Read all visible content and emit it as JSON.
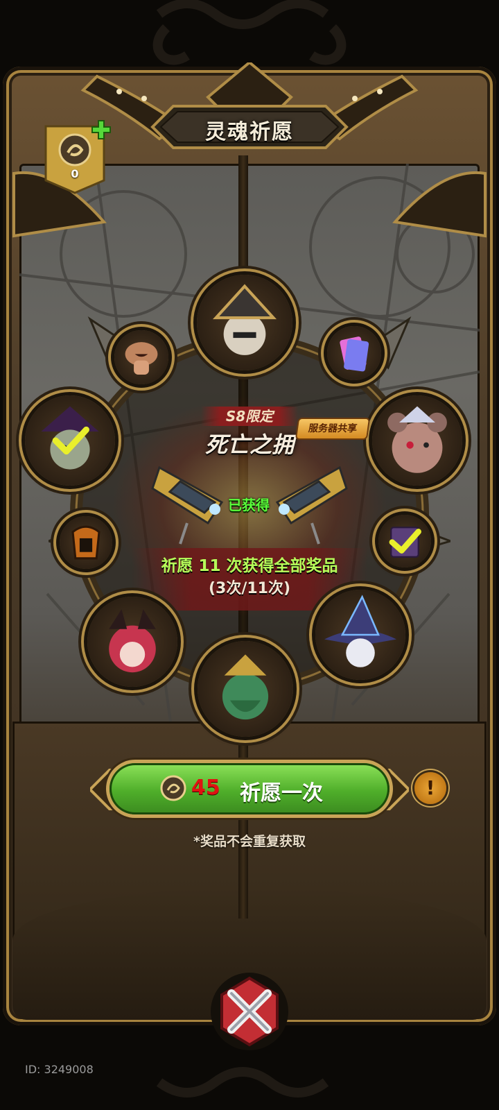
{
  "header": {
    "title": "灵魂祈愿"
  },
  "currency": {
    "amount": "0",
    "icon": "soul-coin-icon"
  },
  "banner": {
    "season_label": "S8限定",
    "item_name": "死亡之拥",
    "server_tag": "服务器共享",
    "status": "已获得",
    "wish_info": "祈愿 11 次获得全部奖品",
    "wish_count": "(3次/11次)"
  },
  "wish_button": {
    "cost": "45",
    "label": "祈愿一次"
  },
  "info_button": {
    "label": "!"
  },
  "note": "*奖品不会重复获取",
  "footer": {
    "id": "ID: 3249008"
  },
  "rewards": [
    {
      "name": "hero-pirate-captain",
      "obtained": false
    },
    {
      "name": "item-card-pack",
      "obtained": false
    },
    {
      "name": "hero-bear-king",
      "obtained": false
    },
    {
      "name": "item-spellbook",
      "obtained": true
    },
    {
      "name": "hero-witch-hat",
      "obtained": false
    },
    {
      "name": "hero-sea-lord",
      "obtained": false
    },
    {
      "name": "hero-red-demon",
      "obtained": false
    },
    {
      "name": "item-mask",
      "obtained": false
    },
    {
      "name": "hero-shadow-mage",
      "obtained": true
    },
    {
      "name": "item-mushroom",
      "obtained": false
    }
  ],
  "colors": {
    "accent_green": "#4fae2a",
    "gold": "#b08d47",
    "cost_red": "#e01212",
    "obtained_green": "#5aff3a"
  }
}
